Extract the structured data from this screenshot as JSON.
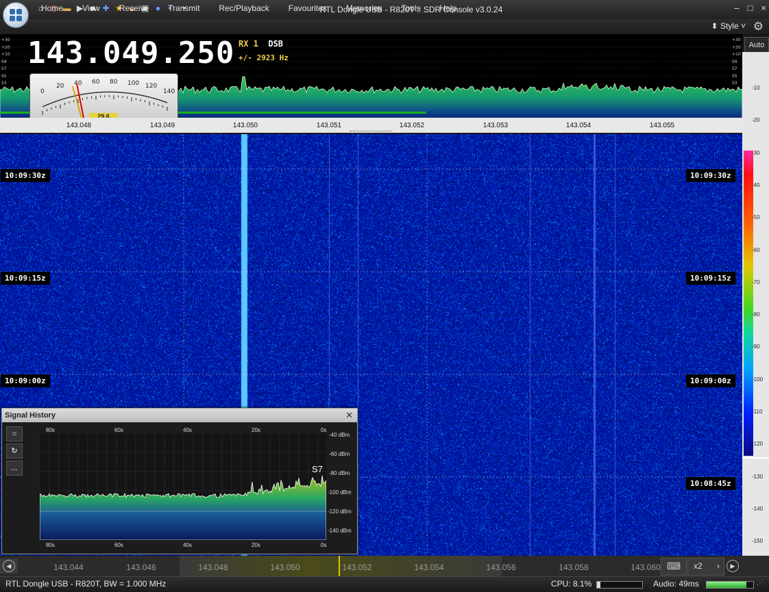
{
  "window": {
    "title": "RTL Dongle USB - R820T :: SDR Console v3.0.24",
    "controls": [
      "–",
      "□",
      "×"
    ]
  },
  "quick_access": [
    "home-icon",
    "lifebuoy-icon",
    "folder-icon",
    "play-icon",
    "stop-icon",
    "plus-icon",
    "star-icon",
    "lock-icon",
    "camera-icon",
    "drop-icon",
    "undo-icon",
    "dropdown-icon"
  ],
  "menu": [
    "Home",
    "View",
    "Receive",
    "Transmit",
    "Rec/Playback",
    "Favourites",
    "Memories",
    "Tools",
    "Help"
  ],
  "style_label": "Style",
  "receiver": {
    "frequency": "143.049.250",
    "rx": "RX 1",
    "mode": "DSB",
    "offset": "+/- 2923 Hz"
  },
  "smeter": {
    "scale": [
      "0",
      "20",
      "40",
      "60",
      "80",
      "100",
      "120",
      "140"
    ],
    "left_labels": [
      "+30",
      "+20",
      "+10",
      "S9",
      "S7",
      "S5",
      "S3"
    ],
    "reading": "29.6"
  },
  "spectrum_axis": [
    "143.048",
    "143.049",
    "143.050",
    "143.051",
    "143.052",
    "143.053",
    "143.054",
    "143.055"
  ],
  "auto_button": "Auto",
  "db_scale": [
    "-10",
    "-20",
    "-30",
    "-40",
    "-50",
    "-60",
    "-70",
    "-80",
    "-90",
    "-100",
    "-110",
    "-120",
    "-130",
    "-140",
    "-150"
  ],
  "waterfall_times": [
    "10:09:30z",
    "10:09:15z",
    "10:09:00z",
    "10:08:45z"
  ],
  "signal_history": {
    "title": "Signal History",
    "buttons": [
      "○",
      "↻",
      "..."
    ],
    "time_labels": [
      "80s",
      "60s",
      "40s",
      "20s",
      "0s"
    ],
    "dbm_labels": [
      "-40 dBm",
      "-60 dBm",
      "-80 dBm",
      "-100 dBm",
      "-120 dBm",
      "-140 dBm"
    ],
    "s_reading": "S7"
  },
  "bottom_axis": [
    "143.044",
    "143.046",
    "143.048",
    "143.050",
    "143.052",
    "143.054",
    "143.056",
    "143.058",
    "143.060"
  ],
  "zoom": "x2",
  "status": {
    "device": "RTL Dongle USB - R820T, BW = 1.000 MHz",
    "cpu": "CPU: 8.1%",
    "audio": "Audio: 49ms",
    "cpu_fraction": 0.08,
    "audio_fraction": 0.85
  }
}
